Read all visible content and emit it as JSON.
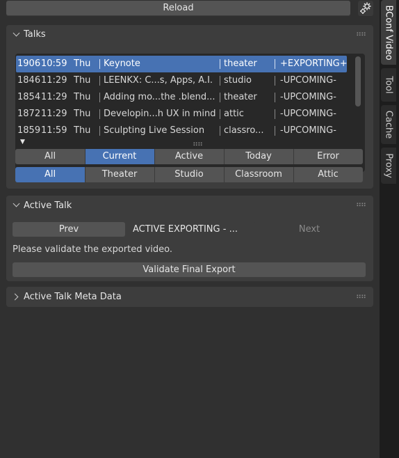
{
  "header": {
    "reload_label": "Reload",
    "settings_icon": "gear-icon"
  },
  "talks_panel": {
    "title": "Talks",
    "rows": [
      {
        "id": "1906",
        "time": "10:59",
        "day": "Thu",
        "title": "Keynote",
        "room": "theater",
        "status": "+EXPORTING+",
        "selected": true
      },
      {
        "id": "1846",
        "time": "11:29",
        "day": "Thu",
        "title": "LEENKX: C...s, Apps, A.I.",
        "room": "studio",
        "status": "-UPCOMING-",
        "selected": false
      },
      {
        "id": "1854",
        "time": "11:29",
        "day": "Thu",
        "title": "Adding mo...the .blend...",
        "room": "theater",
        "status": "-UPCOMING-",
        "selected": false
      },
      {
        "id": "1872",
        "time": "11:29",
        "day": "Thu",
        "title": "Developin...h UX in mind",
        "room": "attic",
        "status": "-UPCOMING-",
        "selected": false
      },
      {
        "id": "1859",
        "time": "11:59",
        "day": "Thu",
        "title": "Sculpting Live Session",
        "room": "classro...",
        "status": "-UPCOMING-",
        "selected": false
      }
    ],
    "filter_state": [
      "All",
      "Current",
      "Active",
      "Today",
      "Error"
    ],
    "filter_state_active": "Current",
    "filter_room": [
      "All",
      "Theater",
      "Studio",
      "Classroom",
      "Attic"
    ],
    "filter_room_active": "All"
  },
  "active_talk_panel": {
    "title": "Active Talk",
    "prev_label": "Prev",
    "status_text": "ACTIVE EXPORTING - ...",
    "next_label": "Next",
    "message": "Please validate the exported video.",
    "validate_label": "Validate Final Export"
  },
  "meta_panel": {
    "title": "Active Talk Meta Data"
  },
  "sidebar_tabs": [
    {
      "label": "BConf Video",
      "active": true
    },
    {
      "label": "Tool",
      "active": false
    },
    {
      "label": "Cache",
      "active": false
    },
    {
      "label": "Proxy",
      "active": false
    }
  ],
  "colors": {
    "accent": "#4772b3",
    "panel": "#3d3d3d",
    "background": "#303030",
    "button": "#545454"
  }
}
